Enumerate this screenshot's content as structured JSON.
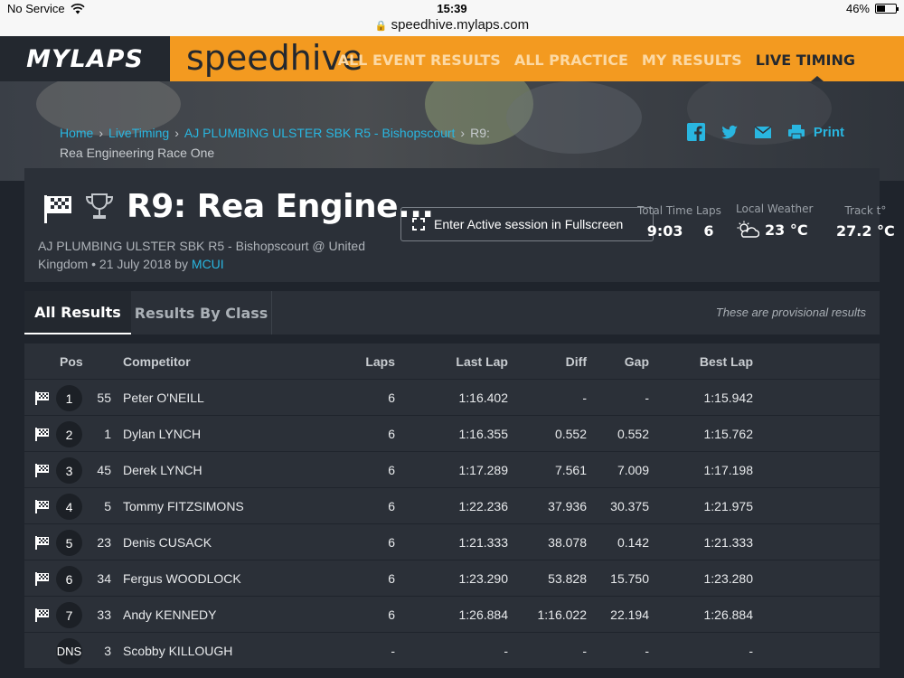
{
  "status": {
    "carrier": "No Service",
    "time": "15:39",
    "url": "speedhive.mylaps.com",
    "battery": "46%",
    "battery_level": 0.46
  },
  "brand": {
    "left": "MYLAPS",
    "right": "speedhive"
  },
  "nav": [
    {
      "label": "ALL EVENT RESULTS",
      "active": false
    },
    {
      "label": "ALL PRACTICE",
      "active": false
    },
    {
      "label": "MY RESULTS",
      "active": false
    },
    {
      "label": "LIVE TIMING",
      "active": true
    }
  ],
  "breadcrumb": {
    "home": "Home",
    "live": "LiveTiming",
    "event": "AJ PLUMBING ULSTER SBK R5 - Bishopscourt",
    "current": "R9:",
    "current_line2": "Rea Engineering Race One"
  },
  "share": {
    "print": "Print"
  },
  "header": {
    "title": "R9: Rea Engine...",
    "subtitle": "AJ PLUMBING ULSTER SBK R5 - Bishopscourt @ United Kingdom • 21 July 2018 by",
    "org": "MCUI",
    "fullscreen": "Enter Active session in Fullscreen"
  },
  "stats": {
    "total_time_label": "Total Time",
    "total_time": "9:03",
    "laps_label": "Laps",
    "laps": "6",
    "weather_label": "Local Weather",
    "weather": "23 °C",
    "track_label": "Track t°",
    "track": "27.2 °C"
  },
  "tabs": {
    "all": "All Results",
    "byclass": "Results By Class",
    "note": "These are provisional results"
  },
  "columns": {
    "pos": "Pos",
    "competitor": "Competitor",
    "laps": "Laps",
    "last": "Last Lap",
    "diff": "Diff",
    "gap": "Gap",
    "best": "Best Lap"
  },
  "rows": [
    {
      "pos": "1",
      "num": "55",
      "name": "Peter O'NEILL",
      "laps": "6",
      "last": "1:16.402",
      "diff": "-",
      "gap": "-",
      "best": "1:15.942",
      "finished": true
    },
    {
      "pos": "2",
      "num": "1",
      "name": "Dylan LYNCH",
      "laps": "6",
      "last": "1:16.355",
      "diff": "0.552",
      "gap": "0.552",
      "best": "1:15.762",
      "finished": true
    },
    {
      "pos": "3",
      "num": "45",
      "name": "Derek LYNCH",
      "laps": "6",
      "last": "1:17.289",
      "diff": "7.561",
      "gap": "7.009",
      "best": "1:17.198",
      "finished": true
    },
    {
      "pos": "4",
      "num": "5",
      "name": "Tommy FITZSIMONS",
      "laps": "6",
      "last": "1:22.236",
      "diff": "37.936",
      "gap": "30.375",
      "best": "1:21.975",
      "finished": true
    },
    {
      "pos": "5",
      "num": "23",
      "name": "Denis CUSACK",
      "laps": "6",
      "last": "1:21.333",
      "diff": "38.078",
      "gap": "0.142",
      "best": "1:21.333",
      "finished": true
    },
    {
      "pos": "6",
      "num": "34",
      "name": "Fergus WOODLOCK",
      "laps": "6",
      "last": "1:23.290",
      "diff": "53.828",
      "gap": "15.750",
      "best": "1:23.280",
      "finished": true
    },
    {
      "pos": "7",
      "num": "33",
      "name": "Andy KENNEDY",
      "laps": "6",
      "last": "1:26.884",
      "diff": "1:16.022",
      "gap": "22.194",
      "best": "1:26.884",
      "finished": true
    },
    {
      "pos": "DNS",
      "num": "3",
      "name": "Scobby KILLOUGH",
      "laps": "-",
      "last": "-",
      "diff": "-",
      "gap": "-",
      "best": "-",
      "finished": false
    }
  ],
  "colors": {
    "accent": "#f39a20",
    "link": "#29b6e0",
    "panel": "#2b3038",
    "background": "#1f242c"
  }
}
